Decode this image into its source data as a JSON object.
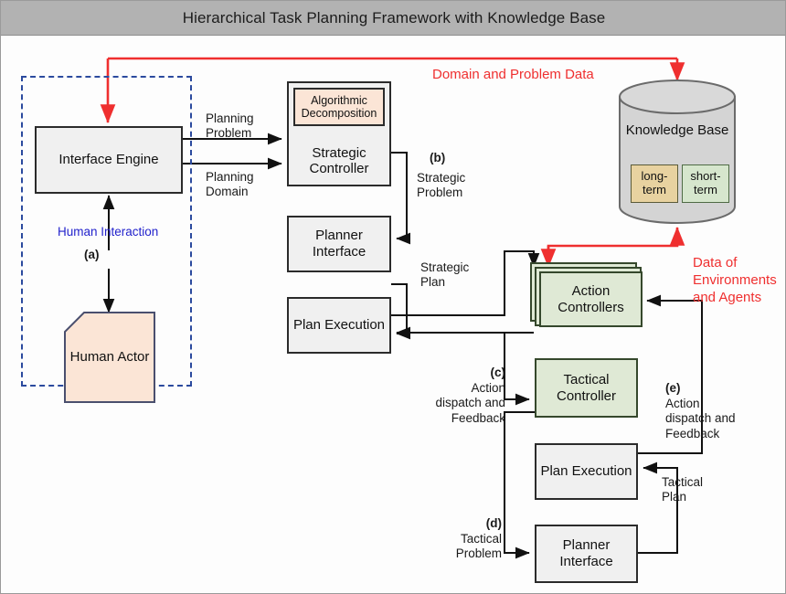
{
  "header": {
    "title": "Hierarchical Task Planning Framework with Knowledge Base"
  },
  "nodes": {
    "interface_engine": "Interface\nEngine",
    "human_actor": "Human\nActor",
    "algorithmic_decomposition": "Algorithmic\nDecomposition",
    "strategic_controller": "Strategic\nController",
    "planner_interface_top": "Planner\nInterface",
    "plan_execution_top": "Plan\nExecution",
    "action_controllers": "Action\nControllers",
    "tactical_controller": "Tactical\nController",
    "plan_execution_bottom": "Plan\nExecution",
    "planner_interface_bottom": "Planner\nInterface",
    "knowledge_base": "Knowledge\nBase",
    "kb_long_term": "long-\nterm",
    "kb_short_term": "short-\nterm"
  },
  "labels": {
    "domain_and_problem_data": "Domain and Problem Data",
    "data_of_environments_and_agents": "Data of\nEnvironments\nand Agents",
    "human_interaction": "Human Interaction",
    "tag_a": "(a)",
    "planning_problem": "Planning\nProblem",
    "planning_domain": "Planning\nDomain",
    "tag_b": "(b)",
    "strategic_problem": "Strategic\nProblem",
    "strategic_plan": "Strategic\nPlan",
    "tag_c": "(c)",
    "c_text": "Action\ndispatch and\nFeedback",
    "tag_d": "(d)",
    "d_text": "Tactical\nProblem",
    "tag_e": "(e)",
    "e_text": "Action\ndispatch and\nFeedback",
    "tactical_plan": "Tactical\nPlan"
  },
  "colors": {
    "title_bar": "#b2b2b2",
    "red_flow": "#ef2f2f",
    "blue_dashed": "#2b4a9e",
    "gray_box_fill": "#f0f0f0",
    "green_box_fill": "#dfe9d5",
    "peach_fill": "#fbe5d6",
    "kb_fill": "#d4d4d4",
    "long_term_fill": "#e8d2a0",
    "short_term_fill": "#d6e6cd"
  }
}
